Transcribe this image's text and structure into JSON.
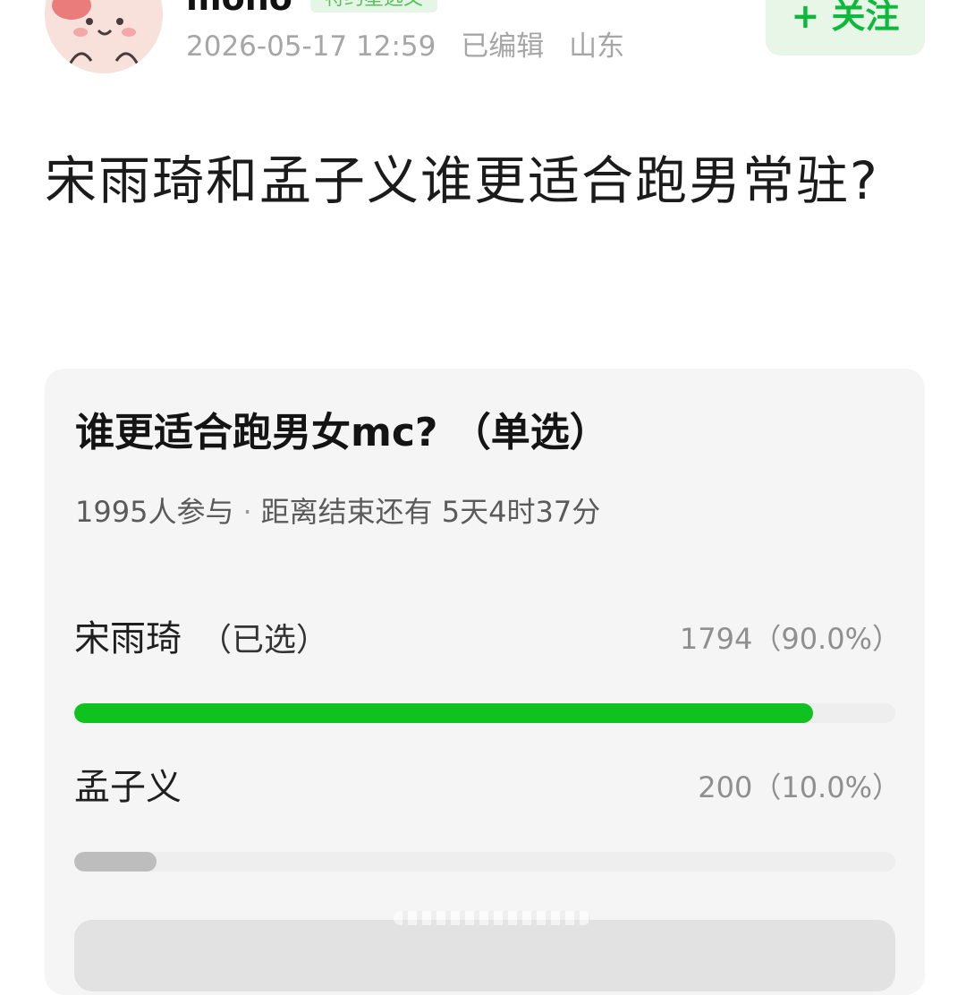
{
  "author": {
    "name": "mono",
    "tag": "特约星选文",
    "timestamp": "2026-05-17 12:59",
    "edited": "已编辑",
    "location": "山东",
    "follow_label": "+ 关注"
  },
  "post": {
    "title": "宋雨琦和孟子义谁更适合跑男常驻?"
  },
  "poll": {
    "question": "谁更适合跑男女mc? （单选）",
    "participants": "1995人参与",
    "separator": "·",
    "deadline": "距离结束还有 5天4时37分",
    "options": [
      {
        "label": "宋雨琦",
        "selected_tag": "（已选）",
        "count_text": "1794（90.0%）",
        "fraction": 0.9,
        "color": "#10c21f"
      },
      {
        "label": "孟子义",
        "selected_tag": "",
        "count_text": "200（10.0%）",
        "fraction": 0.1,
        "color": "#bdbdbd"
      }
    ]
  },
  "colors": {
    "accent_green": "#0bba3a",
    "winning_bar": "#10c21f",
    "losing_bar": "#bdbdbd",
    "card_background": "#f5f5f5"
  },
  "icons": {
    "avatar": "cartoon-avatar-icon"
  }
}
